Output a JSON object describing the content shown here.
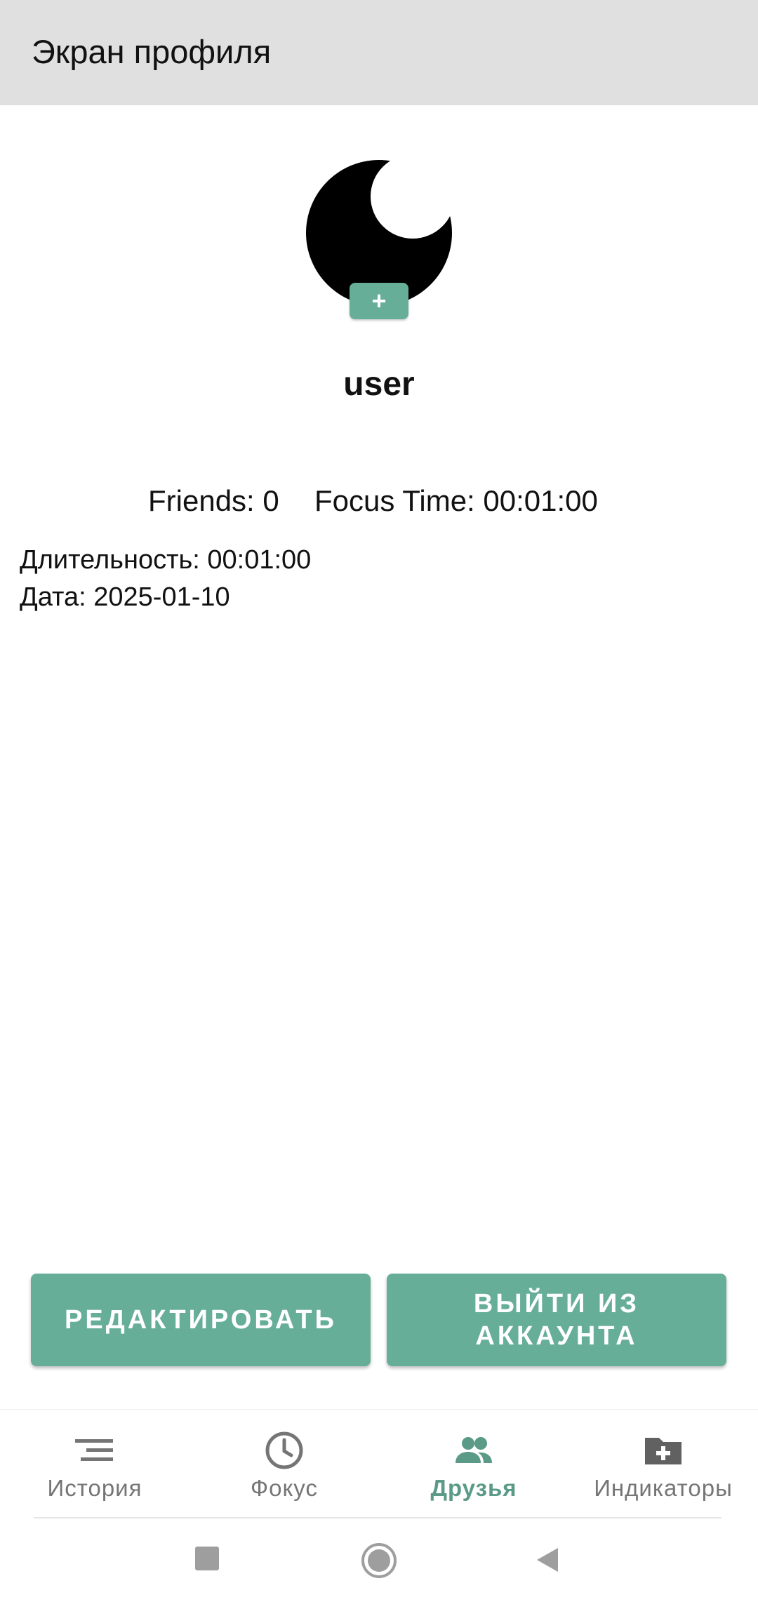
{
  "app_bar": {
    "title": "Экран профиля"
  },
  "profile": {
    "avatar_icon": "crescent-moon-icon",
    "add_photo_label": "+",
    "username": "user"
  },
  "stats": {
    "friends": "Friends: 0",
    "focus_time": "Focus Time: 00:01:00"
  },
  "session": {
    "duration": "Длительность: 00:01:00",
    "date": "Дата: 2025-01-10"
  },
  "actions": {
    "edit_label": "РЕДАКТИРОВАТЬ",
    "logout_label": "ВЫЙТИ ИЗ\nАККАУНТА"
  },
  "bottom_nav": {
    "items": [
      {
        "label": "История",
        "icon": "history-list-icon",
        "active": false
      },
      {
        "label": "Фокус",
        "icon": "clock-icon",
        "active": false
      },
      {
        "label": "Друзья",
        "icon": "friends-icon",
        "active": true
      },
      {
        "label": "Индикаторы",
        "icon": "folder-add-icon",
        "active": false
      }
    ]
  },
  "colors": {
    "accent": "#67ae99",
    "active_nav": "#5a9a86",
    "app_bar_bg": "#e0e0e0",
    "inactive_nav": "#757575"
  },
  "system_nav": {
    "buttons": [
      "recents-icon",
      "home-icon",
      "back-icon"
    ]
  }
}
